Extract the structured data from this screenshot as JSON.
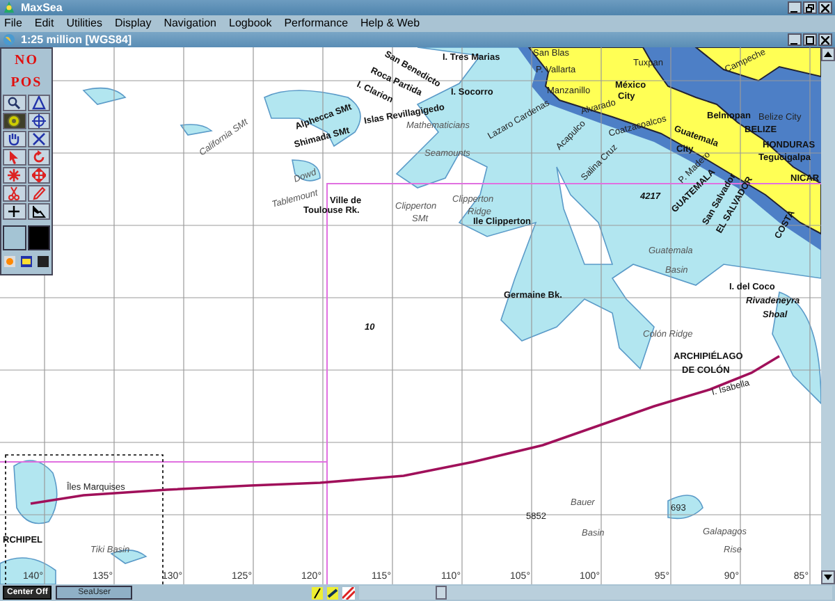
{
  "window": {
    "title": "MaxSea"
  },
  "menu": [
    "File",
    "Edit",
    "Utilities",
    "Display",
    "Navigation",
    "Logbook",
    "Performance",
    "Help & Web"
  ],
  "chart_window": {
    "title": "1:25 million [WGS84]"
  },
  "toolbar": {
    "position_status": "NO POS",
    "tools": [
      {
        "kind": "zoom",
        "selected": false
      },
      {
        "kind": "triangle",
        "selected": false
      },
      {
        "kind": "target",
        "selected": true
      },
      {
        "kind": "crosshair",
        "selected": false
      },
      {
        "kind": "hand",
        "selected": false
      },
      {
        "kind": "cross",
        "selected": false
      },
      {
        "kind": "cursor",
        "selected": false
      },
      {
        "kind": "rotate",
        "selected": false
      },
      {
        "kind": "burst",
        "selected": false
      },
      {
        "kind": "move",
        "selected": false
      },
      {
        "kind": "scissors",
        "selected": false
      },
      {
        "kind": "pencil",
        "selected": false
      },
      {
        "kind": "plus",
        "selected": false
      },
      {
        "kind": "chart",
        "selected": false
      }
    ],
    "swatches": [
      {
        "color": "#a4c4d4"
      },
      {
        "color": "#000000"
      }
    ]
  },
  "map": {
    "labels": [
      {
        "text": "I. Tres Marias",
        "kind": "place"
      },
      {
        "text": "San Blas",
        "kind": "town"
      },
      {
        "text": "P. Vallarta",
        "kind": "town"
      },
      {
        "text": "Tuxpan",
        "kind": "town"
      },
      {
        "text": "Campeche",
        "kind": "town"
      },
      {
        "text": "Manzanillo",
        "kind": "town"
      },
      {
        "text": "México",
        "kind": "place"
      },
      {
        "text": "City",
        "kind": "place"
      },
      {
        "text": "Alvarado",
        "kind": "town"
      },
      {
        "text": "San Benedicto",
        "kind": "place"
      },
      {
        "text": "Roca Partida",
        "kind": "place"
      },
      {
        "text": "I. Clarion",
        "kind": "place"
      },
      {
        "text": "I. Socorro",
        "kind": "place"
      },
      {
        "text": "Islas Revillagigedo",
        "kind": "place"
      },
      {
        "text": "Mathematicians",
        "kind": "feature"
      },
      {
        "text": "Lazaro Cardenas",
        "kind": "town"
      },
      {
        "text": "Acapulco",
        "kind": "town"
      },
      {
        "text": "Coatzacoalcos",
        "kind": "town"
      },
      {
        "text": "Belmopan",
        "kind": "place"
      },
      {
        "text": "Belize City",
        "kind": "town"
      },
      {
        "text": "BELIZE",
        "kind": "place"
      },
      {
        "text": "Guatemala",
        "kind": "place"
      },
      {
        "text": "City",
        "kind": "place"
      },
      {
        "text": "HONDURAS",
        "kind": "place"
      },
      {
        "text": "Tegucigalpa",
        "kind": "place"
      },
      {
        "text": "NICAR",
        "kind": "place"
      },
      {
        "text": "Alphecca SMt",
        "kind": "place"
      },
      {
        "text": "Shimada SMt",
        "kind": "place"
      },
      {
        "text": "California SMt",
        "kind": "feature"
      },
      {
        "text": "Seamounts",
        "kind": "feature"
      },
      {
        "text": "Dowd",
        "kind": "feature"
      },
      {
        "text": "Tablemount",
        "kind": "feature"
      },
      {
        "text": "Ville de",
        "kind": "place"
      },
      {
        "text": "Toulouse Rk.",
        "kind": "place"
      },
      {
        "text": "Clipperton",
        "kind": "feature"
      },
      {
        "text": "SMt",
        "kind": "feature"
      },
      {
        "text": "Clipperton",
        "kind": "feature"
      },
      {
        "text": "Ridge",
        "kind": "feature"
      },
      {
        "text": "Ile Clipperton",
        "kind": "place"
      },
      {
        "text": "4217",
        "kind": "depth"
      },
      {
        "text": "Salina Cruz",
        "kind": "town"
      },
      {
        "text": "P. Madero",
        "kind": "town"
      },
      {
        "text": "GUATEMALA",
        "kind": "place"
      },
      {
        "text": "San Salvador",
        "kind": "place"
      },
      {
        "text": "EL SALVADOR",
        "kind": "place"
      },
      {
        "text": "COSTA",
        "kind": "place"
      },
      {
        "text": "Guatemala",
        "kind": "feature"
      },
      {
        "text": "Basin",
        "kind": "feature"
      },
      {
        "text": "I. del Coco",
        "kind": "place"
      },
      {
        "text": "Rivadeneyra",
        "kind": "depth"
      },
      {
        "text": "Shoal",
        "kind": "depth"
      },
      {
        "text": "Germaine Bk.",
        "kind": "place"
      },
      {
        "text": "10",
        "kind": "depth"
      },
      {
        "text": "Colón Ridge",
        "kind": "feature"
      },
      {
        "text": "ARCHIPIÉLAGO",
        "kind": "place"
      },
      {
        "text": "DE COLÓN",
        "kind": "place"
      },
      {
        "text": "I. Isabella",
        "kind": "town"
      },
      {
        "text": "Îles Marquises",
        "kind": "town"
      },
      {
        "text": "Tiki Basin",
        "kind": "feature"
      },
      {
        "text": "RCHIPEL",
        "kind": "place"
      },
      {
        "text": "Bauer",
        "kind": "feature"
      },
      {
        "text": "Basin",
        "kind": "feature"
      },
      {
        "text": "5852",
        "kind": "town"
      },
      {
        "text": "693",
        "kind": "town"
      },
      {
        "text": "Galapagos",
        "kind": "feature"
      },
      {
        "text": "Rise",
        "kind": "feature"
      }
    ],
    "longitude_labels": [
      "140°",
      "135°",
      "130°",
      "125°",
      "120°",
      "115°",
      "110°",
      "105°",
      "100°",
      "95°",
      "90°",
      "85°"
    ]
  },
  "status_bar": {
    "center_button": "Center Off",
    "user": "SeaUser"
  }
}
